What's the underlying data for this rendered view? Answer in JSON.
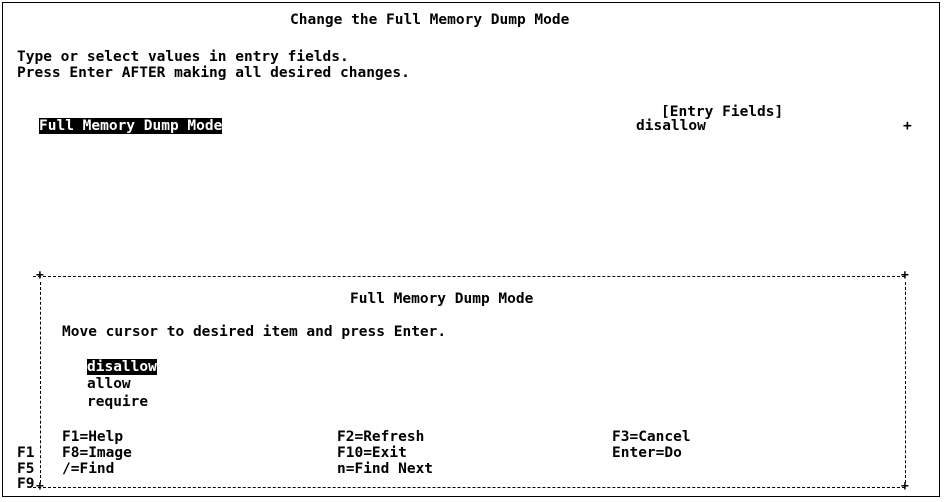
{
  "screen": {
    "title": "Change the Full Memory Dump Mode",
    "instruction_line1": "Type or select values in entry fields.",
    "instruction_line2": "Press Enter AFTER making all desired changes.",
    "entry_fields_header": "[Entry Fields]",
    "field": {
      "label": "Full Memory Dump Mode",
      "value": "disallow",
      "list_indicator": "+"
    }
  },
  "popup": {
    "title": "Full Memory Dump Mode",
    "instruction": "Move cursor to desired item and press Enter.",
    "options": [
      "disallow",
      "allow",
      "require"
    ],
    "selected_option": "disallow",
    "keys": {
      "f1": "F1=Help",
      "f2": "F2=Refresh",
      "f3": "F3=Cancel",
      "f8": "F8=Image",
      "f10": "F10=Exit",
      "enter": "Enter=Do",
      "find": "/=Find",
      "find_next": "n=Find Next"
    }
  },
  "background_keys": {
    "f1": "F1",
    "f5": "F5",
    "f9": "F9"
  }
}
